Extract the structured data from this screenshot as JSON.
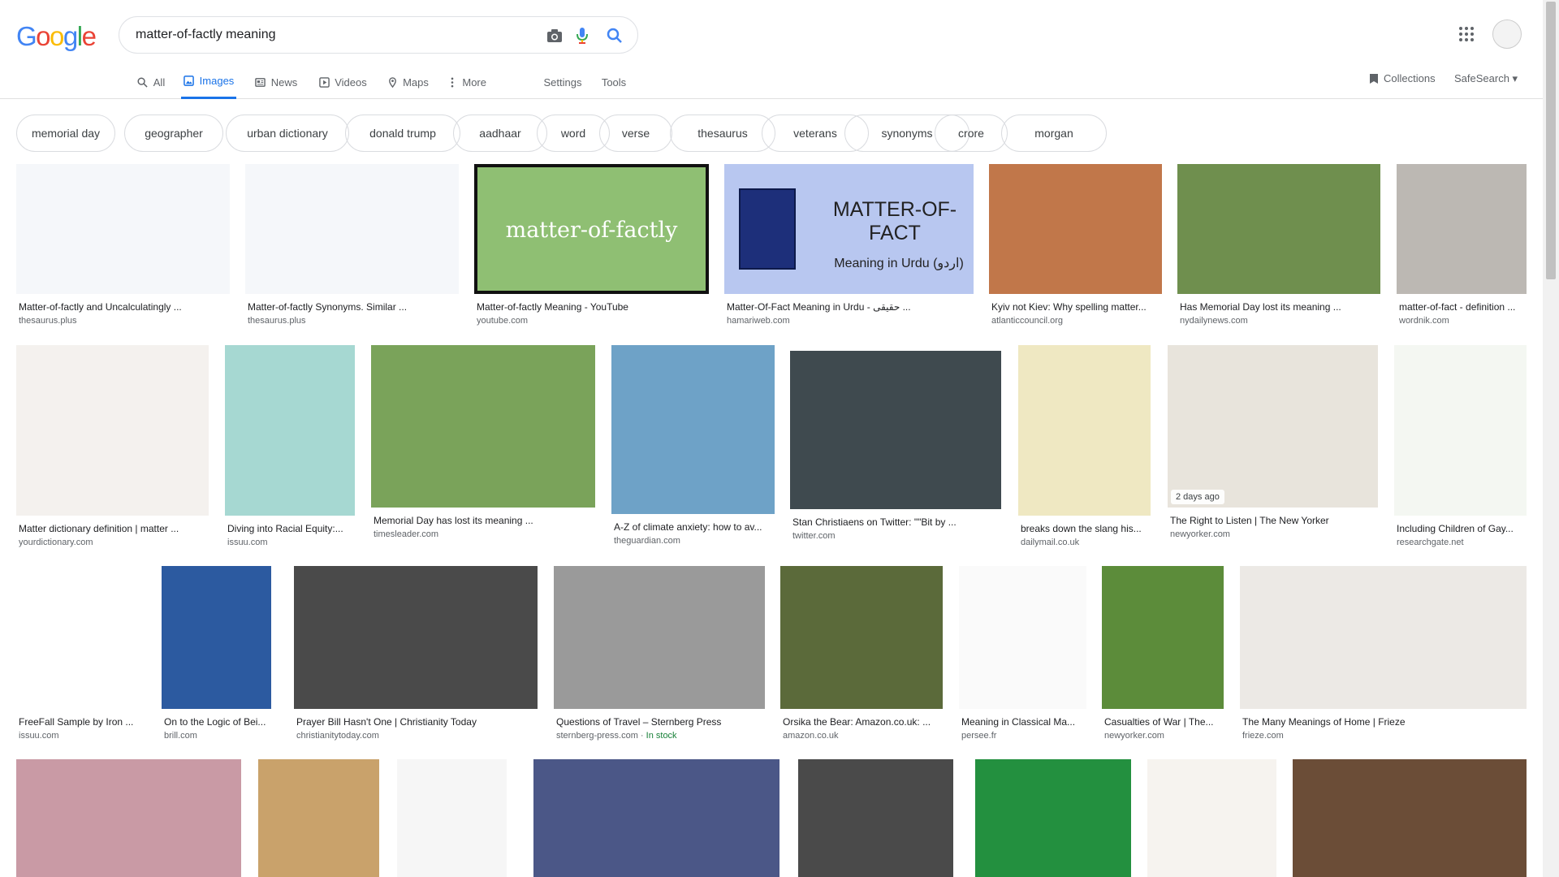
{
  "logo": {
    "text": "Google",
    "colors": [
      "#4285F4",
      "#EA4335",
      "#FBBC05",
      "#4285F4",
      "#34A853",
      "#EA4335"
    ]
  },
  "search": {
    "query": "matter-of-factly meaning"
  },
  "tabs": [
    {
      "label": "All",
      "icon": "search-icon"
    },
    {
      "label": "Images",
      "icon": "image-icon",
      "active": true
    },
    {
      "label": "News",
      "icon": "news-icon"
    },
    {
      "label": "Videos",
      "icon": "video-icon"
    },
    {
      "label": "Maps",
      "icon": "map-icon"
    },
    {
      "label": "More",
      "icon": "more-vert-icon"
    },
    {
      "label": "Settings"
    },
    {
      "label": "Tools"
    }
  ],
  "collections": "Collections",
  "safesearch": "SafeSearch ▾",
  "chips": [
    "memorial day",
    "geographer",
    "urban dictionary",
    "donald trump",
    "aadhaar",
    "word",
    "verse",
    "thesaurus",
    "veterans",
    "synonyms",
    "crore",
    "morgan"
  ],
  "results": [
    {
      "title": "Matter-of-factly and Uncalculatingly ...",
      "source": "thesaurus.plus",
      "color": "#f5f7fa"
    },
    {
      "title": "Matter-of-factly Synonyms. Similar ...",
      "source": "thesaurus.plus",
      "color": "#f5f7fa"
    },
    {
      "title": "Matter-of-factly Meaning - YouTube",
      "source": "youtube.com",
      "color": "#8fbf73",
      "overlay": "matter-of-factly"
    },
    {
      "title": "Matter-Of-Fact Meaning in Urdu - حقیقی ...",
      "source": "hamariweb.com",
      "color": "#b8c7f0",
      "overlay": "MATTER-OF-FACT",
      "overlay2": "Meaning in Urdu (اردو)"
    },
    {
      "title": "Kyiv not Kiev: Why spelling matter...",
      "source": "atlanticcouncil.org",
      "color": "#c1774a"
    },
    {
      "title": "Has Memorial Day lost its meaning ...",
      "source": "nydailynews.com",
      "color": "#6f8f4e"
    },
    {
      "title": "matter-of-fact - definition ...",
      "source": "wordnik.com",
      "color": "#bcb8b3"
    },
    {
      "title": "Matter dictionary definition | matter ...",
      "source": "yourdictionary.com",
      "color": "#f4f1ee"
    },
    {
      "title": "Diving into Racial Equity:...",
      "source": "issuu.com",
      "color": "#a6d8d2"
    },
    {
      "title": "Memorial Day has lost its meaning ...",
      "source": "timesleader.com",
      "color": "#7aa35a"
    },
    {
      "title": "A-Z of climate anxiety: how to av...",
      "source": "theguardian.com",
      "color": "#6ea2c7"
    },
    {
      "title": "Stan Christiaens on Twitter: \"\"Bit by ...",
      "source": "twitter.com",
      "color": "#3f4a4f"
    },
    {
      "title": "breaks down the slang his...",
      "source": "dailymail.co.uk",
      "color": "#efe8c2"
    },
    {
      "title": "The Right to Listen | The New Yorker",
      "source": "newyorker.com",
      "color": "#e8e4dc",
      "badge": "2 days ago"
    },
    {
      "title": "Including Children of Gay...",
      "source": "researchgate.net",
      "color": "#f4f7f2"
    },
    {
      "title": "FreeFall Sample by Iron ...",
      "source": "issuu.com",
      "color": "#ffffff"
    },
    {
      "title": "On to the Logic of Bei...",
      "source": "brill.com",
      "color": "#2c5aa0"
    },
    {
      "title": "Prayer Bill Hasn't One | Christianity Today",
      "source": "christianitytoday.com",
      "color": "#4a4a4a"
    },
    {
      "title": "Questions of Travel – Sternberg Press",
      "source": "sternberg-press.com",
      "stock": "In stock",
      "color": "#9a9a9a"
    },
    {
      "title": "Orsika the Bear: Amazon.co.uk: ...",
      "source": "amazon.co.uk",
      "color": "#5b6a3a"
    },
    {
      "title": "Meaning in Classical Ma...",
      "source": "persee.fr",
      "color": "#fafafa"
    },
    {
      "title": "Casualties of War | The...",
      "source": "newyorker.com",
      "color": "#5c8c3a"
    },
    {
      "title": "The Many Meanings of Home | Frieze",
      "source": "frieze.com",
      "color": "#ece9e5"
    },
    {
      "color": "#c99aa5"
    },
    {
      "color": "#c9a26b"
    },
    {
      "color": "#f6f6f6"
    },
    {
      "color": "#4b5787"
    },
    {
      "color": "#4a4a4a"
    },
    {
      "color": "#23903f"
    },
    {
      "color": "#f6f3ef"
    },
    {
      "color": "#6b4d37"
    }
  ]
}
